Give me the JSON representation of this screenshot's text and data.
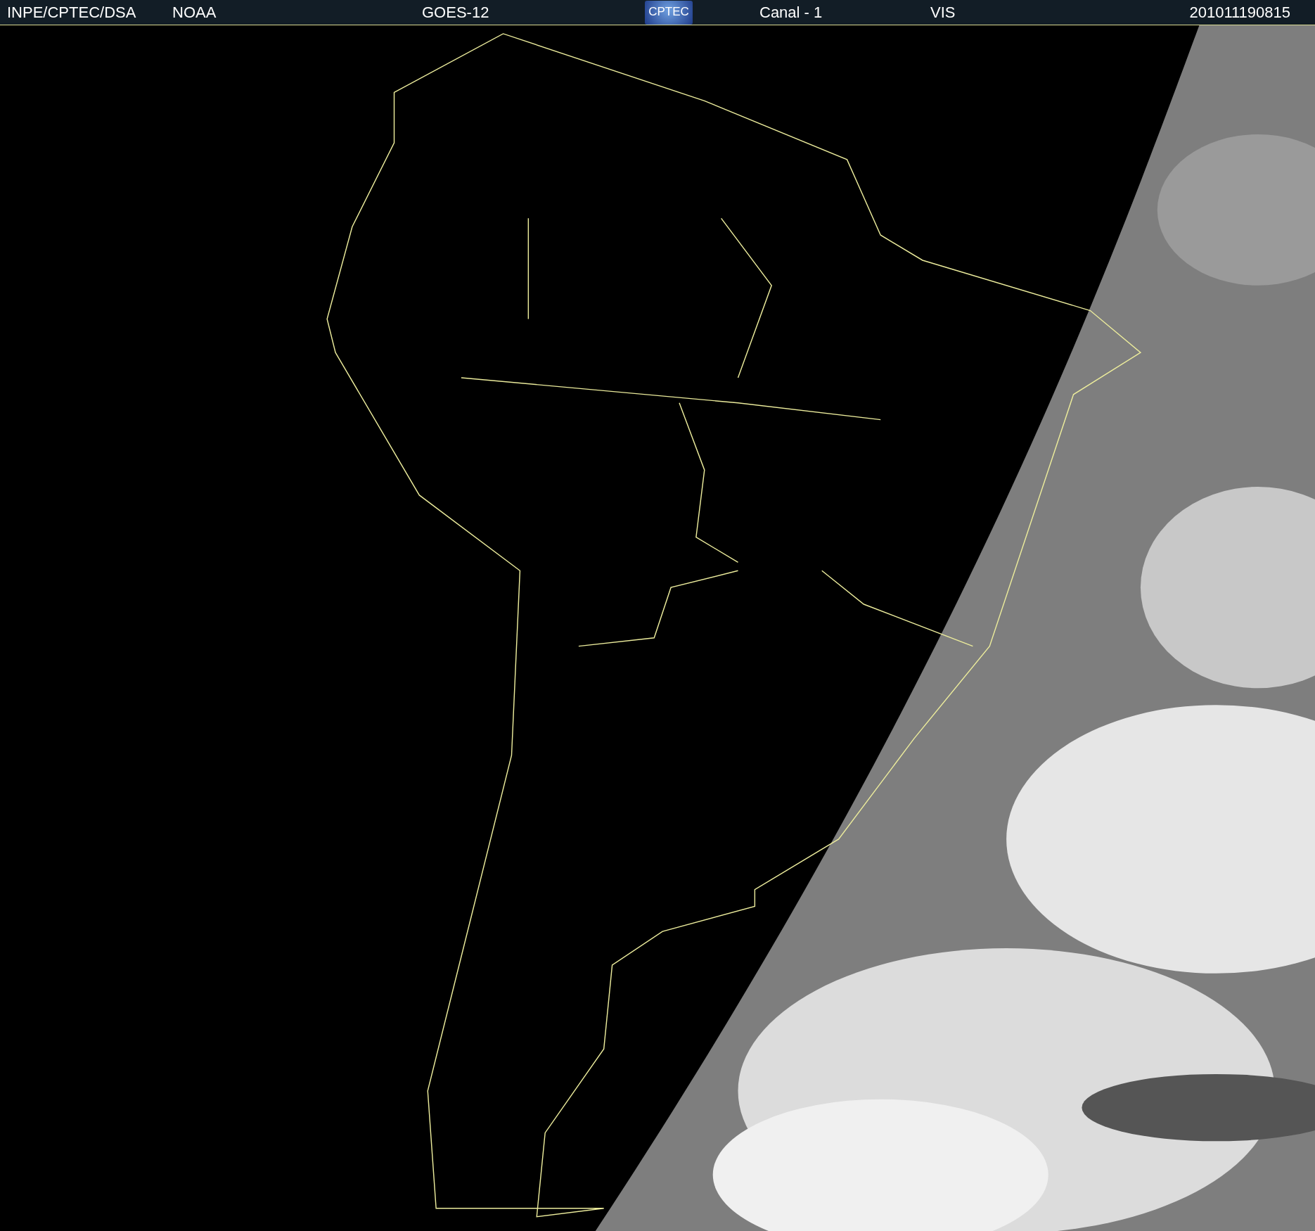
{
  "header": {
    "items": [
      {
        "kind": "text",
        "text": "INPE/CPTEC/DSA"
      },
      {
        "kind": "text",
        "text": "NOAA"
      },
      {
        "kind": "text",
        "text": "GOES-12"
      },
      {
        "kind": "logo",
        "text": "CPTEC"
      },
      {
        "kind": "text",
        "text": "Canal - 1"
      },
      {
        "kind": "text",
        "text": "VIS"
      },
      {
        "kind": "timestamp",
        "text": "201011190815"
      }
    ]
  }
}
